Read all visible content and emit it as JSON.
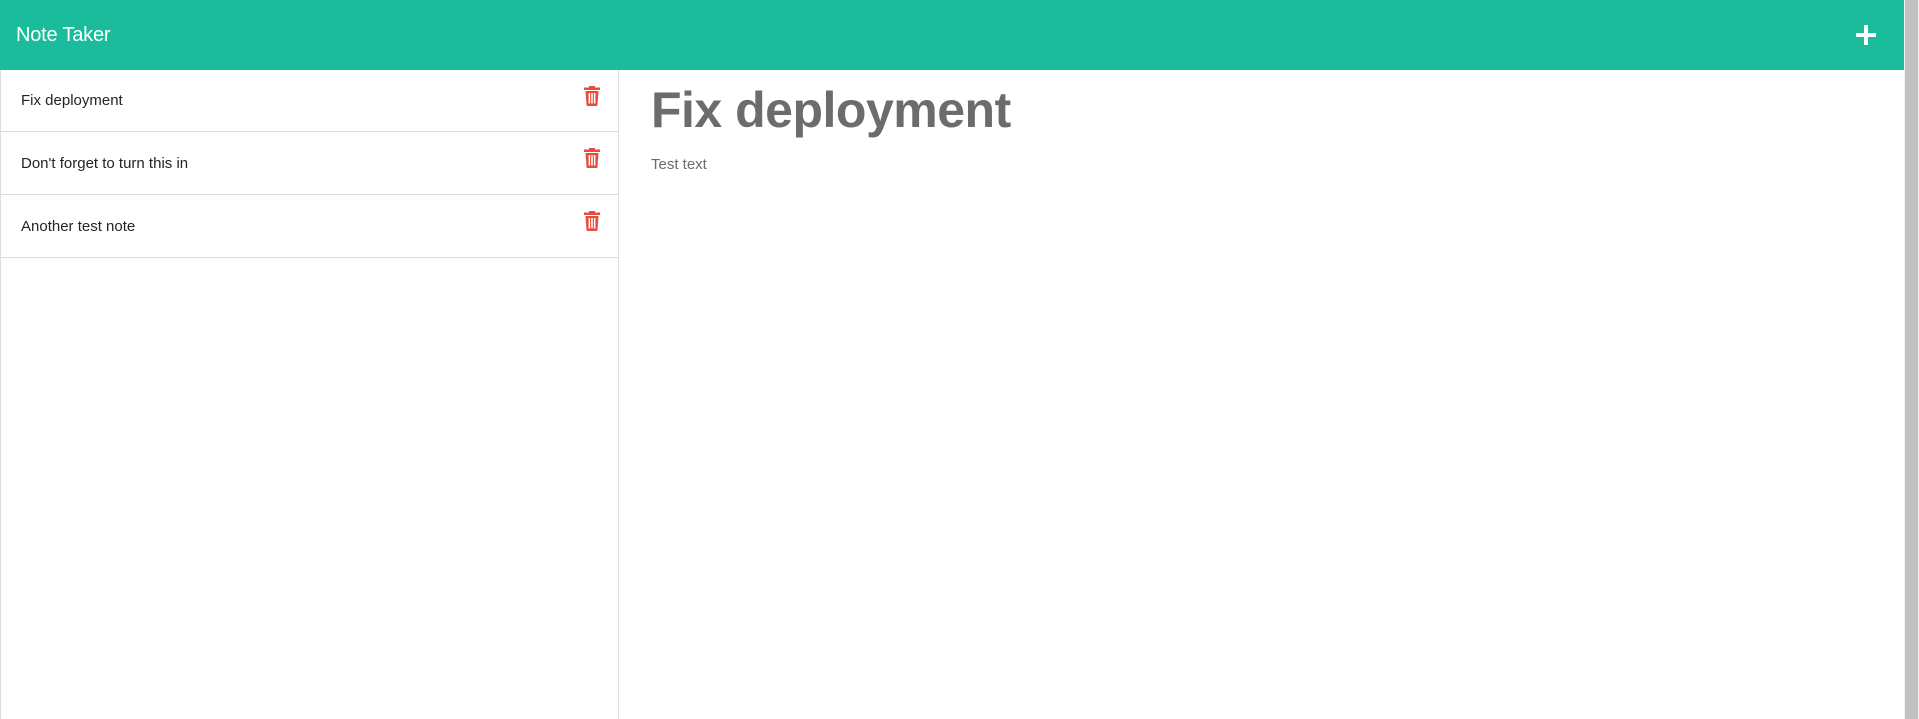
{
  "navbar": {
    "brand": "Note Taker",
    "new_note_icon": "plus-icon",
    "background_color": "#1abc9c"
  },
  "sidebar": {
    "notes": [
      {
        "title": "Fix deployment",
        "delete_icon": "trash-icon"
      },
      {
        "title": "Don't forget to turn this in",
        "delete_icon": "trash-icon"
      },
      {
        "title": "Another test note",
        "delete_icon": "trash-icon"
      }
    ],
    "delete_icon_color": "#e74c3c"
  },
  "editor": {
    "title": "Fix deployment",
    "text": "Test text"
  }
}
